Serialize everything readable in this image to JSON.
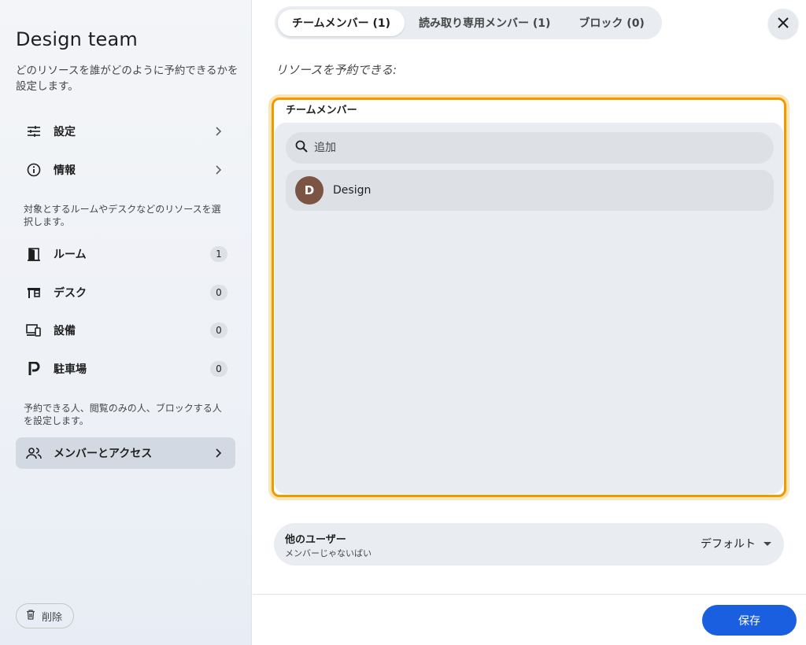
{
  "sidebar": {
    "title": "Design team",
    "description": "どのリソースを誰がどのように予約できるかを設定します。",
    "items_top": [
      {
        "label": "設定",
        "icon": "tune-icon"
      },
      {
        "label": "情報",
        "icon": "info-icon"
      }
    ],
    "resources_hint": "対象とするルームやデスクなどのリソースを選択します。",
    "resources": [
      {
        "label": "ルーム",
        "count": "1",
        "icon": "door-icon"
      },
      {
        "label": "デスク",
        "count": "0",
        "icon": "desk-icon"
      },
      {
        "label": "設備",
        "count": "0",
        "icon": "devices-icon"
      },
      {
        "label": "駐車場",
        "count": "0",
        "icon": "parking-icon"
      }
    ],
    "access_hint": "予約できる人、閲覧のみの人、ブロックする人を設定します。",
    "access_item": {
      "label": "メンバーとアクセス",
      "icon": "group-icon"
    },
    "delete_label": "削除"
  },
  "tabs": [
    {
      "label": "チームメンバー (1)",
      "active": true
    },
    {
      "label": "読み取り専用メンバー (1)",
      "active": false
    },
    {
      "label": "ブロック (0)",
      "active": false
    }
  ],
  "main": {
    "subtitle": "リソースを予約できる:",
    "panel_title": "チームメンバー",
    "search_placeholder": "追加",
    "members": [
      {
        "initial": "D",
        "name": "Design",
        "avatar_color": "#7b5443"
      }
    ],
    "other_users": {
      "title": "他のユーザー",
      "subtitle": "メンバーじゃないばい",
      "value": "デフォルト"
    }
  },
  "footer": {
    "save_label": "保存"
  },
  "colors": {
    "accent": "#1a5fe0",
    "focus_outline": "#f29900"
  }
}
